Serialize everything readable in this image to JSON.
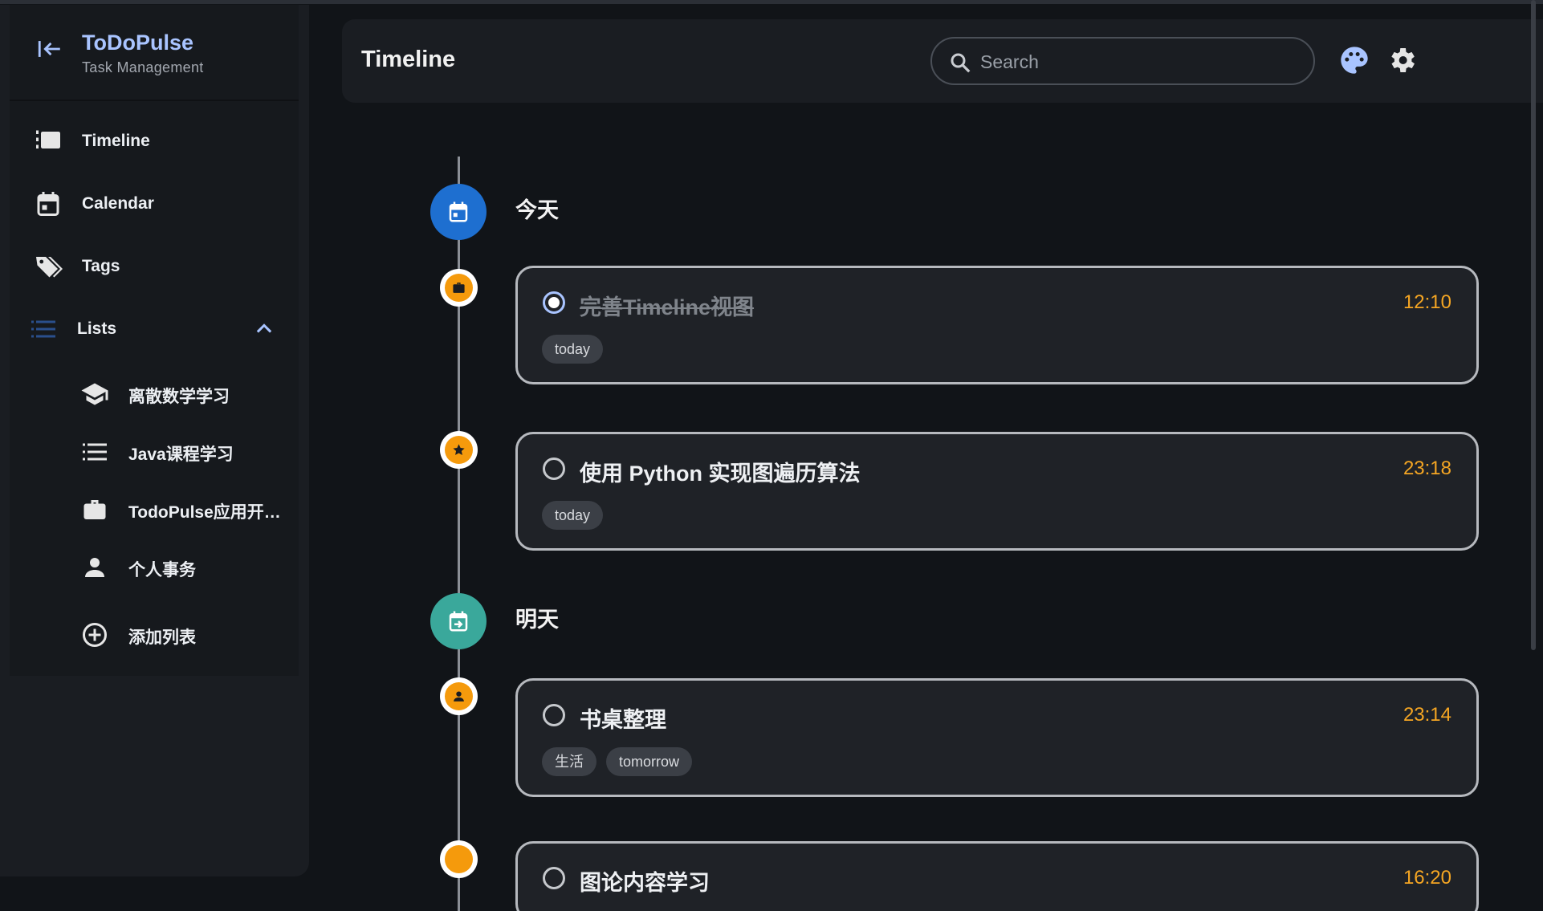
{
  "colors": {
    "accent": "#a9c4ff",
    "bg": "#111418",
    "surface": "#1a1d22",
    "card": "#1f2227",
    "time": "#f5a623",
    "today_node": "#1e6fd0",
    "tomorrow_node": "#3aa89b",
    "dot": "#f59a0c"
  },
  "app": {
    "title": "ToDoPulse",
    "subtitle": "Task Management"
  },
  "sidebar": {
    "nav": [
      {
        "label": "Timeline",
        "icon": "timeline-icon"
      },
      {
        "label": "Calendar",
        "icon": "calendar-icon"
      },
      {
        "label": "Tags",
        "icon": "tags-icon"
      }
    ],
    "lists_label": "Lists",
    "lists": [
      {
        "label": "离散数学学习",
        "icon": "school-icon"
      },
      {
        "label": "Java课程学习",
        "icon": "list-icon"
      },
      {
        "label": "TodoPulse应用开…",
        "icon": "briefcase-icon"
      },
      {
        "label": "个人事务",
        "icon": "person-icon"
      },
      {
        "label": "添加列表",
        "icon": "add-circle-icon"
      }
    ]
  },
  "header": {
    "title": "Timeline",
    "search_placeholder": "Search"
  },
  "timeline": {
    "days": [
      {
        "label": "今天",
        "tasks": [
          {
            "title": "完善Timeline视图",
            "time": "12:10",
            "done": true,
            "tags": [
              "today"
            ],
            "icon": "briefcase-icon"
          },
          {
            "title": "使用 Python 实现图遍历算法",
            "time": "23:18",
            "done": false,
            "tags": [
              "today"
            ],
            "icon": "star-icon"
          }
        ]
      },
      {
        "label": "明天",
        "tasks": [
          {
            "title": "书桌整理",
            "time": "23:14",
            "done": false,
            "tags": [
              "生活",
              "tomorrow"
            ],
            "icon": "person-icon"
          },
          {
            "title": "图论内容学习",
            "time": "16:20",
            "done": false,
            "tags": [],
            "icon": "dot-icon"
          }
        ]
      }
    ]
  }
}
